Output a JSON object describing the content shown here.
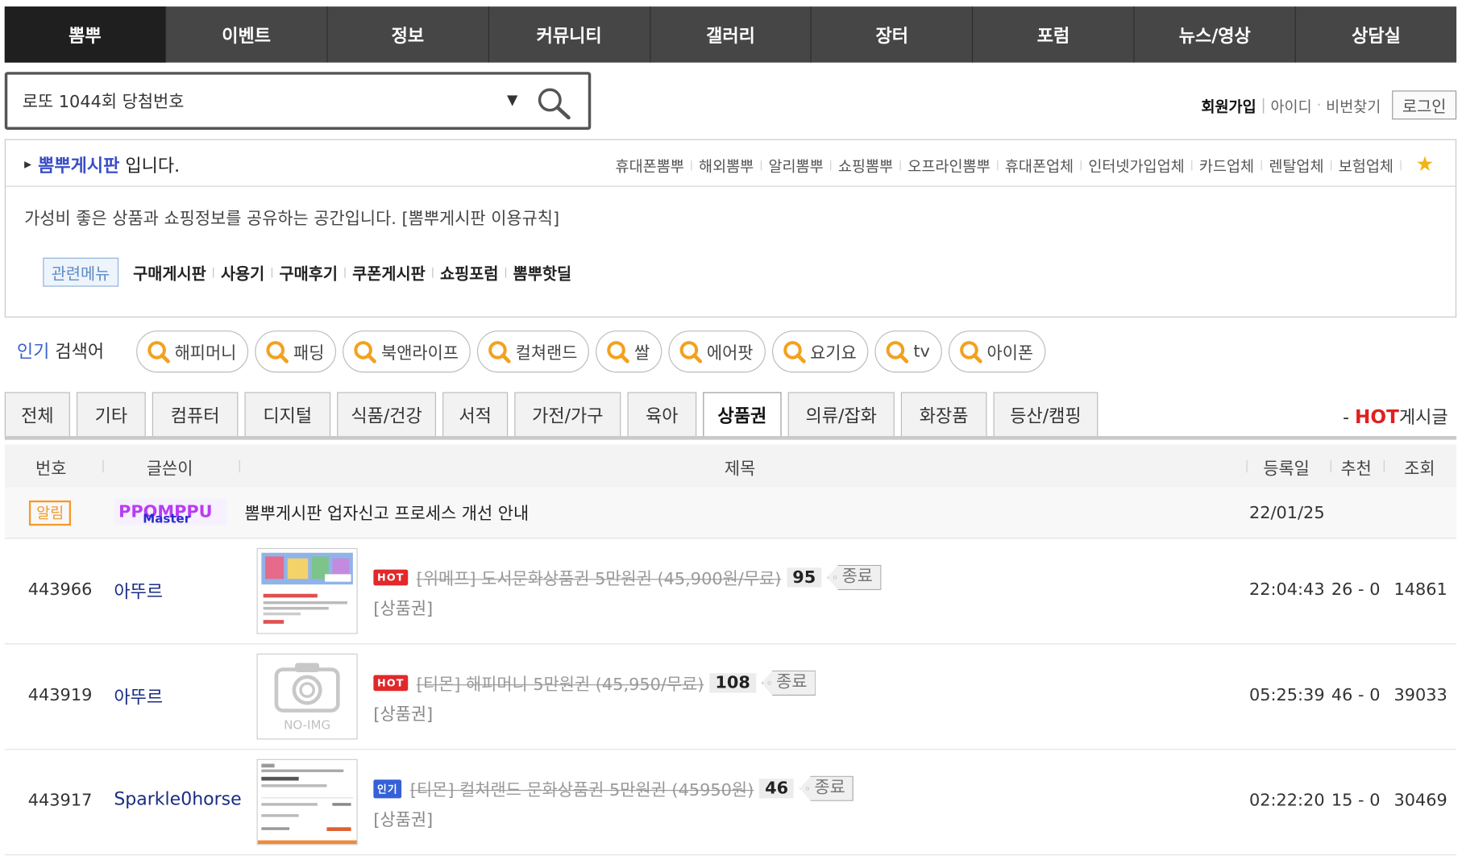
{
  "nav": {
    "items": [
      "뽐뿌",
      "이벤트",
      "정보",
      "커뮤니티",
      "갤러리",
      "장터",
      "포럼",
      "뉴스/영상",
      "상담실"
    ]
  },
  "search": {
    "value": "로또 1044회 당첨번호",
    "arrow": "▼"
  },
  "auth": {
    "join": "회원가입",
    "id": "아이디",
    "pw": "비번찾기",
    "login": "로그인"
  },
  "board": {
    "name": "뽐뿌게시판",
    "suffix": "입니다.",
    "links": [
      "휴대폰뽐뿌",
      "해외뽐뿌",
      "알리뽐뿌",
      "쇼핑뽐뿌",
      "오프라인뽐뿌",
      "휴대폰업체",
      "인터넷가입업체",
      "카드업체",
      "렌탈업체",
      "보험업체"
    ],
    "description": "가성비 좋은 상품과 쇼핑정보를 공유하는 공간입니다. [뽐뿌게시판 이용규칙]",
    "related_label": "관련메뉴",
    "related": [
      "구매게시판",
      "사용기",
      "구매후기",
      "쿠폰게시판",
      "쇼핑포럼",
      "뽐뿌핫딜"
    ]
  },
  "popular": {
    "label_hl": "인기",
    "label": "검색어",
    "chips": [
      "해피머니",
      "패딩",
      "북앤라이프",
      "컬쳐랜드",
      "쌀",
      "에어팟",
      "요기요",
      "tv",
      "아이폰"
    ]
  },
  "categories": {
    "tabs": [
      "전체",
      "기타",
      "컴퓨터",
      "디지털",
      "식품/건강",
      "서적",
      "가전/가구",
      "육아",
      "상품권",
      "의류/잡화",
      "화장품",
      "등산/캠핑"
    ],
    "active": "상품권"
  },
  "hot": {
    "dash": "-",
    "hot": "HOT",
    "label": "게시글"
  },
  "table": {
    "headers": {
      "num": "번호",
      "writer": "글쓴이",
      "title": "제목",
      "date": "등록일",
      "rec": "추천",
      "views": "조회"
    },
    "notice": {
      "badge": "알림",
      "writer_logo": "PPOMPPU Master",
      "title": "뽐뿌게시판 업자신고 프로세스 개선 안내",
      "date": "22/01/25"
    },
    "rows": [
      {
        "num": "443966",
        "writer": "아뚜르",
        "badge": "HOT",
        "title": "[위메프] 도서문화상품권 5만원권 (45,900원/무료)",
        "comments": "95",
        "status": "종료",
        "category": "[상품권]",
        "time": "22:04:43",
        "rec": "26 - 0",
        "views": "14861",
        "thumb": "image"
      },
      {
        "num": "443919",
        "writer": "아뚜르",
        "badge": "HOT",
        "title": "[티몬] 해피머니 5만원권 (45,950/무료)",
        "comments": "108",
        "status": "종료",
        "category": "[상품권]",
        "time": "05:25:39",
        "rec": "46 - 0",
        "views": "39033",
        "thumb": "NO-IMG"
      },
      {
        "num": "443917",
        "writer": "Sparkle0horse",
        "badge": "인기",
        "title": "[티몬] 컬쳐랜드 문화상품권 5만원권 (45950원)",
        "comments": "46",
        "status": "종료",
        "category": "[상품권]",
        "time": "02:22:20",
        "rec": "15 - 0",
        "views": "30469",
        "thumb": "image"
      }
    ]
  },
  "colors": {
    "nav_bg": "#464646",
    "board_link": "#3a4fc7",
    "hot_red": "#e2282a",
    "pop_blue": "#3560d8",
    "notice_orange": "#f39a2c"
  }
}
